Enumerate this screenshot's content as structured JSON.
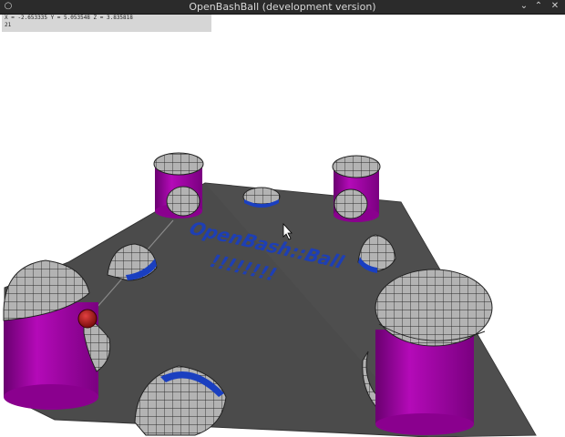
{
  "window": {
    "title": "OpenBashBall (development version)",
    "controls": {
      "left_icon": "circle-icon",
      "right_icons": [
        "minimize-icon",
        "maximize-icon",
        "close-icon"
      ]
    }
  },
  "hud": {
    "position": "X = -2.653335 Y = 5.053548 Z = 3.835818",
    "fps": "21"
  },
  "scene": {
    "floor_text_line1": "OpenBash::Ball",
    "floor_text_line2": "!!!!!!!!",
    "colors": {
      "floor": "#4a4a4a",
      "pillar": "#9a0a9a",
      "mesh": "#a9a9a9",
      "bumper_stripe": "#1a3fc0",
      "ball": "#b01818",
      "text": "#1b3bb0"
    }
  }
}
